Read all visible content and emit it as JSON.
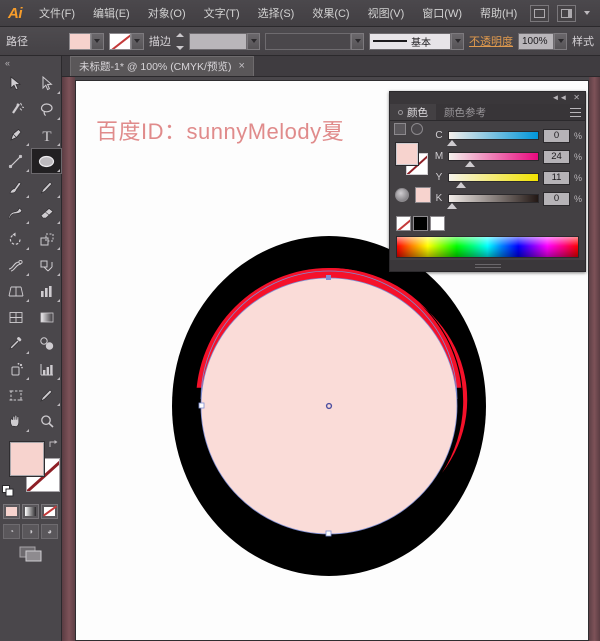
{
  "app": {
    "name": "Ai",
    "logo_color": "#f79d2b"
  },
  "menubar": {
    "items": [
      {
        "label": "文件(F)",
        "name": "menu-file"
      },
      {
        "label": "编辑(E)",
        "name": "menu-edit"
      },
      {
        "label": "对象(O)",
        "name": "menu-object"
      },
      {
        "label": "文字(T)",
        "name": "menu-type"
      },
      {
        "label": "选择(S)",
        "name": "menu-select"
      },
      {
        "label": "效果(C)",
        "name": "menu-effect"
      },
      {
        "label": "视图(V)",
        "name": "menu-view"
      },
      {
        "label": "窗口(W)",
        "name": "menu-window"
      },
      {
        "label": "帮助(H)",
        "name": "menu-help"
      }
    ],
    "bridge_icon": "bridge-icon",
    "arrange_icon": "arrange-documents-icon"
  },
  "optionsbar": {
    "object_label": "路径",
    "fill_color": "#f6d2cd",
    "stroke_label": "描边",
    "stroke_weight": "",
    "stroke_profile": "",
    "brush_label": "基本",
    "opacity_label": "不透明度",
    "opacity_value": "100%",
    "styles_label": "样式"
  },
  "document": {
    "tab_title": "未标题-1* @ 100% (CMYK/预览)",
    "close_label": "×"
  },
  "toolbar": {
    "collapse_icon": "collapse-panel-icon",
    "tools": [
      {
        "name": "selection-tool",
        "icon": "arrow-black"
      },
      {
        "name": "direct-selection-tool",
        "icon": "arrow-white"
      },
      {
        "name": "magic-wand-tool",
        "icon": "magic-wand"
      },
      {
        "name": "lasso-tool",
        "icon": "lasso"
      },
      {
        "name": "pen-tool",
        "icon": "pen"
      },
      {
        "name": "type-tool",
        "icon": "type-T"
      },
      {
        "name": "line-segment-tool",
        "icon": "line"
      },
      {
        "name": "ellipse-tool",
        "icon": "ellipse",
        "active": true
      },
      {
        "name": "paintbrush-tool",
        "icon": "paintbrush"
      },
      {
        "name": "pencil-tool",
        "icon": "pencil"
      },
      {
        "name": "blob-brush-tool",
        "icon": "blob-brush"
      },
      {
        "name": "eraser-tool",
        "icon": "eraser"
      },
      {
        "name": "rotate-tool",
        "icon": "rotate"
      },
      {
        "name": "scale-tool",
        "icon": "scale"
      },
      {
        "name": "width-tool",
        "icon": "width"
      },
      {
        "name": "shape-builder-tool",
        "icon": "shape-builder"
      },
      {
        "name": "perspective-grid-tool",
        "icon": "perspective-grid"
      },
      {
        "name": "graph-tool",
        "icon": "graph"
      },
      {
        "name": "mesh-tool",
        "icon": "mesh"
      },
      {
        "name": "gradient-tool",
        "icon": "gradient"
      },
      {
        "name": "eyedropper-tool",
        "icon": "eyedropper"
      },
      {
        "name": "blend-tool",
        "icon": "blend"
      },
      {
        "name": "symbol-sprayer-tool",
        "icon": "symbol-sprayer"
      },
      {
        "name": "column-graph-tool",
        "icon": "column-graph"
      },
      {
        "name": "artboard-tool",
        "icon": "artboard"
      },
      {
        "name": "slice-tool",
        "icon": "slice"
      },
      {
        "name": "hand-tool",
        "icon": "hand"
      },
      {
        "name": "zoom-tool",
        "icon": "magnifier"
      }
    ],
    "fill_color": "#f7d3ce",
    "stroke_color": "none",
    "swap_icon": "swap-fill-stroke-icon",
    "default_icon": "default-fill-stroke-icon",
    "modes": [
      {
        "name": "color-mode-button",
        "type": "color"
      },
      {
        "name": "gradient-mode-button",
        "type": "gradient"
      },
      {
        "name": "none-mode-button",
        "type": "none"
      }
    ],
    "screen_modes": [
      {
        "name": "normal-screen-mode-button"
      },
      {
        "name": "fullscreen-menubar-mode-button"
      },
      {
        "name": "fullscreen-mode-button"
      }
    ],
    "change_screen_icon": "change-screen-mode-icon"
  },
  "artwork": {
    "heading_text": "百度ID：sunnyMelody夏",
    "heading_color": "#e08b8b",
    "shapes": {
      "outer_ellipse_color": "#000000",
      "crescent_color": "#f5112a",
      "inner_circle_color": "#fadcd8",
      "selection_path_color": "#7f8fd4",
      "anchor_color": "#7f8fd4"
    }
  },
  "color_panel": {
    "tabs": [
      {
        "label": "颜色",
        "name": "tab-color",
        "active": true
      },
      {
        "label": "颜色参考",
        "name": "tab-color-guide",
        "active": false
      }
    ],
    "collapse_icon": "collapse-icon",
    "close_icon": "close-icon",
    "menu_icon": "panel-menu-icon",
    "fill_color": "#f7d3ce",
    "stroke_color": "none",
    "sliders": [
      {
        "label": "C",
        "value": "0",
        "percent": "%",
        "pos": 3
      },
      {
        "label": "M",
        "value": "24",
        "percent": "%",
        "pos": 24
      },
      {
        "label": "Y",
        "value": "11",
        "percent": "%",
        "pos": 13
      },
      {
        "label": "K",
        "value": "0",
        "percent": "%",
        "pos": 3
      }
    ],
    "swatches": [
      {
        "name": "swatch-none",
        "type": "none"
      },
      {
        "name": "swatch-black",
        "type": "black"
      },
      {
        "name": "swatch-white",
        "type": "white"
      }
    ],
    "spectrum_name": "color-spectrum-ramp"
  }
}
